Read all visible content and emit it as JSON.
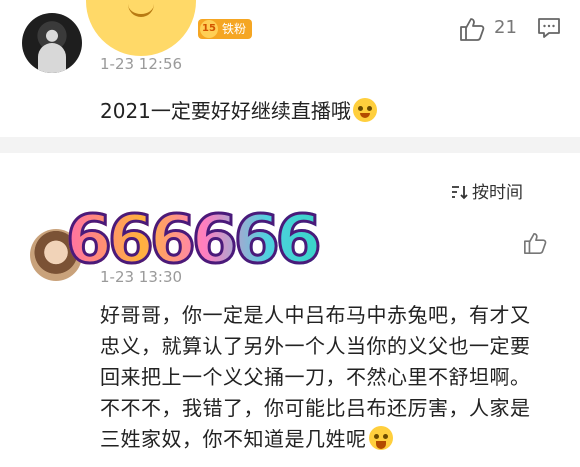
{
  "comment1": {
    "badge_level": "15",
    "badge_label": "铁粉",
    "time": "1-23 12:56",
    "like_count": "21",
    "text": "2021一定要好好继续直播哦"
  },
  "sort": {
    "label": "按时间"
  },
  "comment2": {
    "sticker_text": "666666",
    "time": "1-23 13:30",
    "text": "好哥哥，你一定是人中吕布马中赤兔吧，有才又忠义，就算认了另外一个人当你的义父也一定要回来把上一个义父捅一刀，不然心里不舒坦啊。不不不，我错了，你可能比吕布还厉害，人家是三姓家奴，你不知道是几姓呢"
  },
  "icons": {
    "like": "thumbs-up-icon",
    "reply": "comment-icon",
    "sort": "sort-icon",
    "emoji_1": "pleading-face-emoji",
    "emoji_2": "laughing-face-emoji"
  },
  "colors": {
    "badge": "#f5a623",
    "divider": "#f3f3f3",
    "meta_text": "#9a9a9a"
  }
}
